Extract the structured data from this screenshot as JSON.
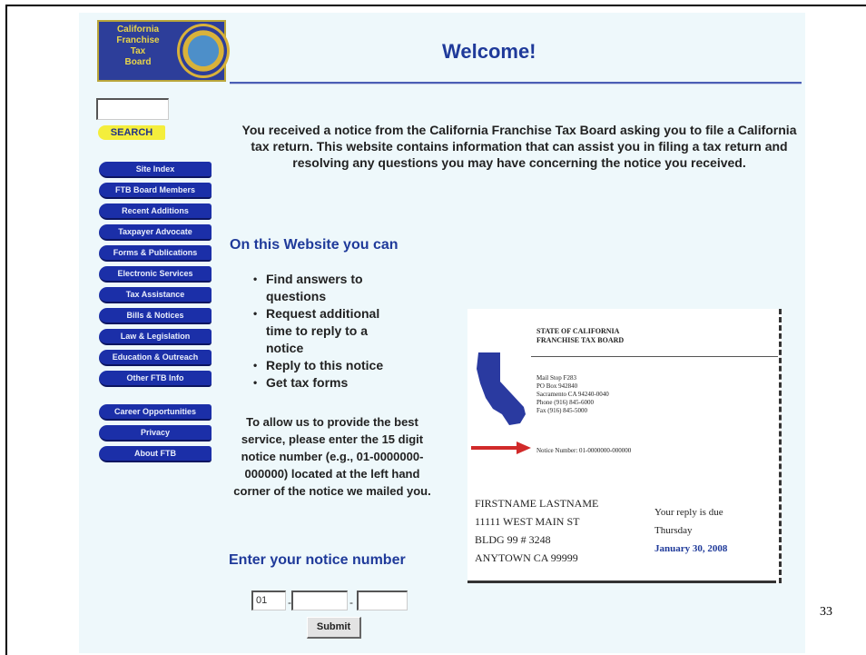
{
  "logo": {
    "lines": [
      "California",
      "Franchise",
      "Tax",
      "Board"
    ]
  },
  "header": {
    "title": "Welcome!"
  },
  "search": {
    "button_label": "SEARCH"
  },
  "nav": {
    "group1": [
      "Site Index",
      "FTB Board Members",
      "Recent Additions",
      "Taxpayer Advocate",
      "Forms & Publications",
      "Electronic Services",
      "Tax Assistance",
      "Bills & Notices",
      "Law & Legislation",
      "Education & Outreach",
      "Other FTB Info"
    ],
    "group2": [
      "Career Opportunities",
      "Privacy",
      "About FTB"
    ]
  },
  "intro": {
    "text": "You received a notice from the California Franchise Tax Board asking you to file a California tax return.  This website contains information that can assist you in filing a tax return and resolving any questions you may have concerning the notice you received."
  },
  "on_site": {
    "title": "On this Website you can",
    "items": [
      "Find answers to questions",
      "Request additional time to reply to a notice",
      "Reply to this notice",
      "Get tax forms"
    ]
  },
  "allow_text": "To allow us to provide the best service, please enter the 15 digit notice number (e.g., 01-0000000-000000) located at the left hand corner of the notice we mailed you.",
  "notice_entry": {
    "title": "Enter your notice number",
    "field1_value": "01",
    "field2_value": "",
    "field3_value": "",
    "submit_label": "Submit"
  },
  "notice_sample": {
    "header_lines": [
      "STATE OF CALIFORNIA",
      "FRANCHISE TAX BOARD"
    ],
    "address_lines": [
      "Mail Stop F283",
      "PO Box 942840",
      "Sacramento CA 94240-0040",
      "Phone (916) 845-6000",
      "Fax (916) 845-5000"
    ],
    "notice_number_line": "Notice Number: 01-0000000-000000",
    "recipient": [
      "FIRSTNAME LASTNAME",
      "11111 WEST MAIN ST",
      "BLDG 99 # 3248",
      "ANYTOWN CA 99999"
    ],
    "reply_label": "Your reply is due",
    "reply_day": "Thursday",
    "reply_date": "January 30, 2008"
  },
  "slide": {
    "number": "33"
  },
  "colors": {
    "accent": "#1f3a9a",
    "nav_bg": "#1b2fa8",
    "search_bg": "#f4ee3c",
    "arrow": "#d12a2a",
    "map": "#2a3aa0"
  }
}
